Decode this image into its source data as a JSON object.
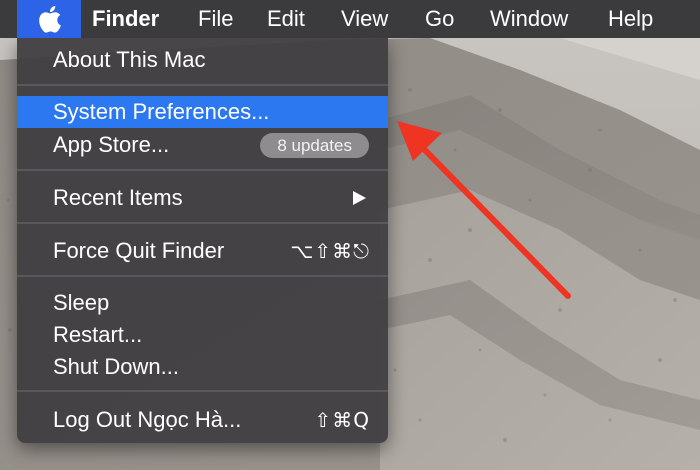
{
  "menubar": {
    "apple_icon": "apple-logo-icon",
    "app_name": "Finder",
    "menus": [
      "File",
      "Edit",
      "View",
      "Go",
      "Window",
      "Help"
    ]
  },
  "apple_menu": {
    "about": "About This Mac",
    "system_preferences": "System Preferences...",
    "app_store": "App Store...",
    "app_store_badge": "8 updates",
    "recent_items": "Recent Items",
    "force_quit": "Force Quit Finder",
    "force_quit_shortcut": "⌥⇧⌘⎋",
    "sleep": "Sleep",
    "restart": "Restart...",
    "shut_down": "Shut Down...",
    "log_out": "Log Out Ngọc Hà...",
    "log_out_shortcut": "⇧⌘Q",
    "highlighted": "system_preferences"
  },
  "colors": {
    "menubar_bg": "#3b3a3c",
    "apple_button_active": "#2d63e6",
    "highlight": "#2c78f0",
    "annotation_arrow": "#ee3423"
  }
}
